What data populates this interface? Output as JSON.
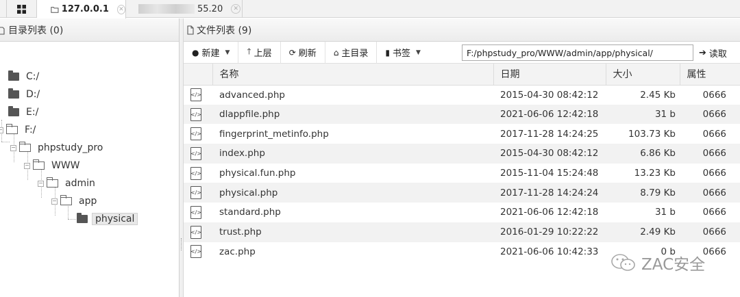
{
  "tabs": [
    {
      "label": "127.0.0.1"
    },
    {
      "label": "55.20"
    }
  ],
  "left_panel": {
    "title": "目录列表 (0)",
    "tree": [
      {
        "label": "C:/"
      },
      {
        "label": "D:/"
      },
      {
        "label": "E:/"
      },
      {
        "label": "F:/"
      },
      {
        "label": "phpstudy_pro"
      },
      {
        "label": "WWW"
      },
      {
        "label": "admin"
      },
      {
        "label": "app"
      },
      {
        "label": "physical"
      }
    ]
  },
  "right_panel": {
    "title": "文件列表 (9)",
    "toolbar": {
      "new_label": "新建",
      "up_label": "上层",
      "refresh_label": "刷新",
      "home_label": "主目录",
      "bookmark_label": "书签",
      "path_value": "F:/phpstudy_pro/WWW/admin/app/physical/",
      "read_label": "读取"
    },
    "columns": {
      "name": "名称",
      "date": "日期",
      "size": "大小",
      "attr": "属性"
    },
    "files": [
      {
        "name": "advanced.php",
        "date": "2015-04-30 08:42:12",
        "size": "2.45 Kb",
        "attr": "0666"
      },
      {
        "name": "dlappfile.php",
        "date": "2021-06-06 12:42:18",
        "size": "31 b",
        "attr": "0666"
      },
      {
        "name": "fingerprint_metinfo.php",
        "date": "2017-11-28 14:24:25",
        "size": "103.73 Kb",
        "attr": "0666"
      },
      {
        "name": "index.php",
        "date": "2015-04-30 08:42:12",
        "size": "6.86 Kb",
        "attr": "0666"
      },
      {
        "name": "physical.fun.php",
        "date": "2015-11-04 15:24:48",
        "size": "13.23 Kb",
        "attr": "0666"
      },
      {
        "name": "physical.php",
        "date": "2017-11-28 14:24:24",
        "size": "8.79 Kb",
        "attr": "0666"
      },
      {
        "name": "standard.php",
        "date": "2021-06-06 12:42:18",
        "size": "31 b",
        "attr": "0666"
      },
      {
        "name": "trust.php",
        "date": "2016-01-29 10:22:22",
        "size": "2.49 Kb",
        "attr": "0666"
      },
      {
        "name": "zac.php",
        "date": "2021-06-06 10:42:33",
        "size": "0 b",
        "attr": "0666"
      }
    ]
  },
  "watermark": {
    "text": "ZAC安全"
  }
}
